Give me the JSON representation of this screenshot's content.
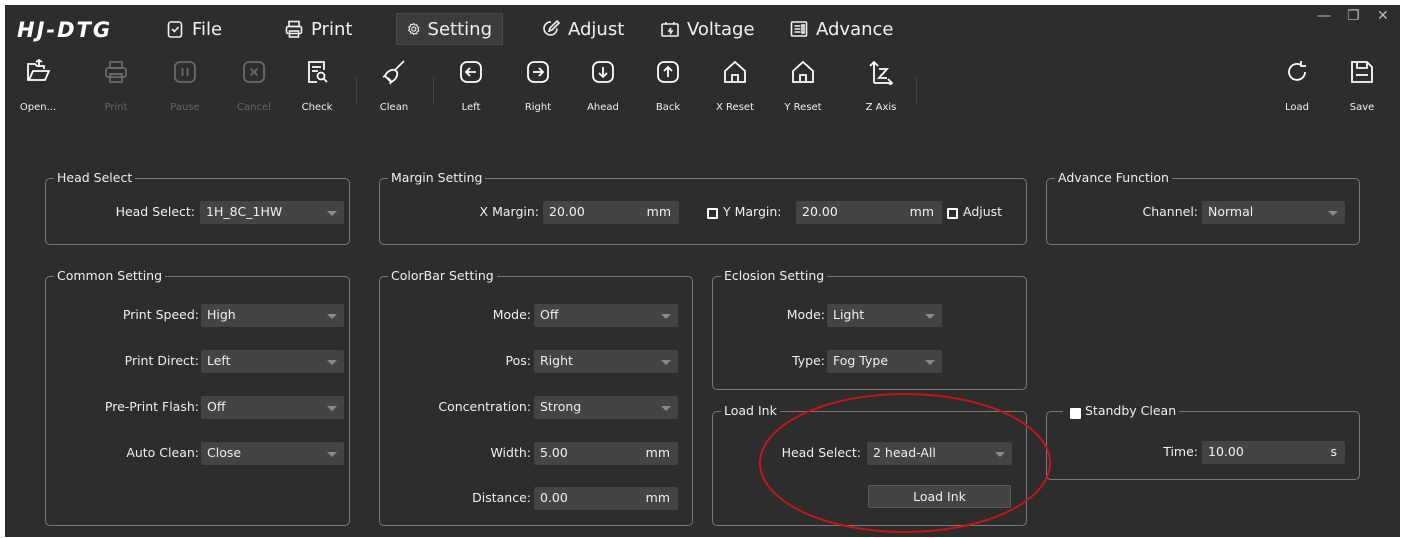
{
  "app": {
    "logo": "HJ-DTG"
  },
  "menu": [
    {
      "label": "File",
      "icon": "clipboard-check-icon"
    },
    {
      "label": "Print",
      "icon": "printer-icon"
    },
    {
      "label": "Setting",
      "icon": "gear-icon",
      "active": true
    },
    {
      "label": "Adjust",
      "icon": "edit-circle-icon"
    },
    {
      "label": "Voltage",
      "icon": "battery-icon"
    },
    {
      "label": "Advance",
      "icon": "list-box-icon"
    }
  ],
  "window_controls": {
    "minimize": "—",
    "restore": "❐",
    "close": "✕"
  },
  "toolbar": [
    {
      "label": "Open...",
      "icon": "open-folder-icon",
      "enabled": true
    },
    {
      "label": "Print",
      "icon": "printer-icon",
      "enabled": false
    },
    {
      "label": "Pause",
      "icon": "pause-icon",
      "enabled": false
    },
    {
      "label": "Cancel",
      "icon": "cancel-icon",
      "enabled": false
    },
    {
      "label": "Check",
      "icon": "check-document-icon",
      "enabled": true
    },
    {
      "label": "Clean",
      "icon": "brush-icon",
      "enabled": true
    },
    {
      "label": "Left",
      "icon": "arrow-left-icon",
      "enabled": true
    },
    {
      "label": "Right",
      "icon": "arrow-right-icon",
      "enabled": true
    },
    {
      "label": "Ahead",
      "icon": "arrow-down-icon",
      "enabled": true
    },
    {
      "label": "Back",
      "icon": "arrow-up-icon",
      "enabled": true
    },
    {
      "label": "X Reset",
      "icon": "home-icon",
      "enabled": true
    },
    {
      "label": "Y Reset",
      "icon": "home-icon",
      "enabled": true
    },
    {
      "label": "Z Axis",
      "icon": "z-axis-icon",
      "enabled": true
    },
    {
      "label": "Load",
      "icon": "reload-icon",
      "enabled": true
    },
    {
      "label": "Save",
      "icon": "save-icon",
      "enabled": true
    }
  ],
  "head_select_panel": {
    "title": "Head Select",
    "label": "Head Select:",
    "value": "1H_8C_1HW"
  },
  "margin_panel": {
    "title": "Margin Setting",
    "x_label": "X Margin:",
    "x_value": "20.00",
    "x_unit": "mm",
    "y_label": "Y Margin:",
    "y_value": "20.00",
    "y_unit": "mm",
    "y_checked": true,
    "adjust_label": "Adjust",
    "adjust_checked": true
  },
  "advance_panel": {
    "title": "Advance Function",
    "label": "Channel:",
    "value": "Normal"
  },
  "common_panel": {
    "title": "Common Setting",
    "rows": [
      {
        "label": "Print Speed:",
        "value": "High"
      },
      {
        "label": "Print Direct:",
        "value": "Left"
      },
      {
        "label": "Pre-Print Flash:",
        "value": "Off"
      },
      {
        "label": "Auto Clean:",
        "value": "Close"
      }
    ]
  },
  "colorbar_panel": {
    "title": "ColorBar Setting",
    "mode_label": "Mode:",
    "mode_value": "Off",
    "pos_label": "Pos:",
    "pos_value": "Right",
    "conc_label": "Concentration:",
    "conc_value": "Strong",
    "width_label": "Width:",
    "width_value": "5.00",
    "width_unit": "mm",
    "distance_label": "Distance:",
    "distance_value": "0.00",
    "distance_unit": "mm"
  },
  "eclosion_panel": {
    "title": "Eclosion Setting",
    "mode_label": "Mode:",
    "mode_value": "Light",
    "type_label": "Type:",
    "type_value": "Fog Type"
  },
  "load_ink_panel": {
    "title": "Load Ink",
    "head_label": "Head Select:",
    "head_value": "2 head-All",
    "button_label": "Load Ink"
  },
  "standby_panel": {
    "title": "Standby Clean",
    "checked": false,
    "time_label": "Time:",
    "time_value": "10.00",
    "time_unit": "s"
  },
  "colors": {
    "background": "#2d2d2d",
    "control": "#444444",
    "border": "#7a7a7a",
    "highlight_circle": "#c8161d"
  }
}
